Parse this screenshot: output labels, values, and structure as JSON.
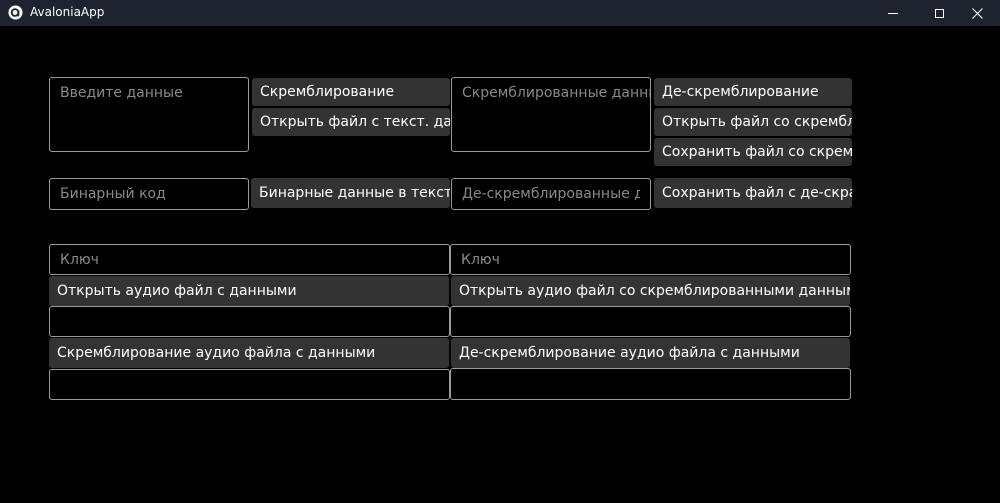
{
  "window": {
    "title": "AvaloniaApp",
    "icon": "avalonia-logo-icon",
    "controls": [
      "minimize-icon",
      "maximize-icon",
      "close-icon"
    ]
  },
  "text_section": {
    "input_placeholder": "Введите данные",
    "scramble_label": "Скремблирование",
    "open_text_file_label": "Открыть файл с текст. дан",
    "scrambled_placeholder": "Скремблированные данны",
    "descramble_label": "Де-скремблирование",
    "open_scrambled_file_label": "Открыть файл со скрембл",
    "save_scrambled_file_label": "Сохранить файл со скрем(",
    "binary_placeholder": "Бинарный код",
    "binary_to_text_label": "Бинарные данные в текст",
    "descrambled_placeholder": "Де-скремблированные да",
    "save_descrambled_file_label": "Сохранить файл с де-скра"
  },
  "audio_left": {
    "key_placeholder": "Ключ",
    "open_audio_label": "Открыть аудио файл с данными",
    "path_value": "",
    "scramble_audio_label": "Скремблирование аудио файла с данными",
    "result_value": ""
  },
  "audio_right": {
    "key_placeholder": "Ключ",
    "open_audio_label": "Открыть аудио файл со скремблированными данными",
    "path_value": "",
    "descramble_audio_label": "Де-скремблирование аудио файла с данными",
    "result_value": ""
  },
  "colors": {
    "background": "#000000",
    "titlebar": "#1f2330",
    "button": "#333333",
    "border": "#9a9a9a",
    "placeholder": "#8a8a8a",
    "text": "#ffffff"
  }
}
